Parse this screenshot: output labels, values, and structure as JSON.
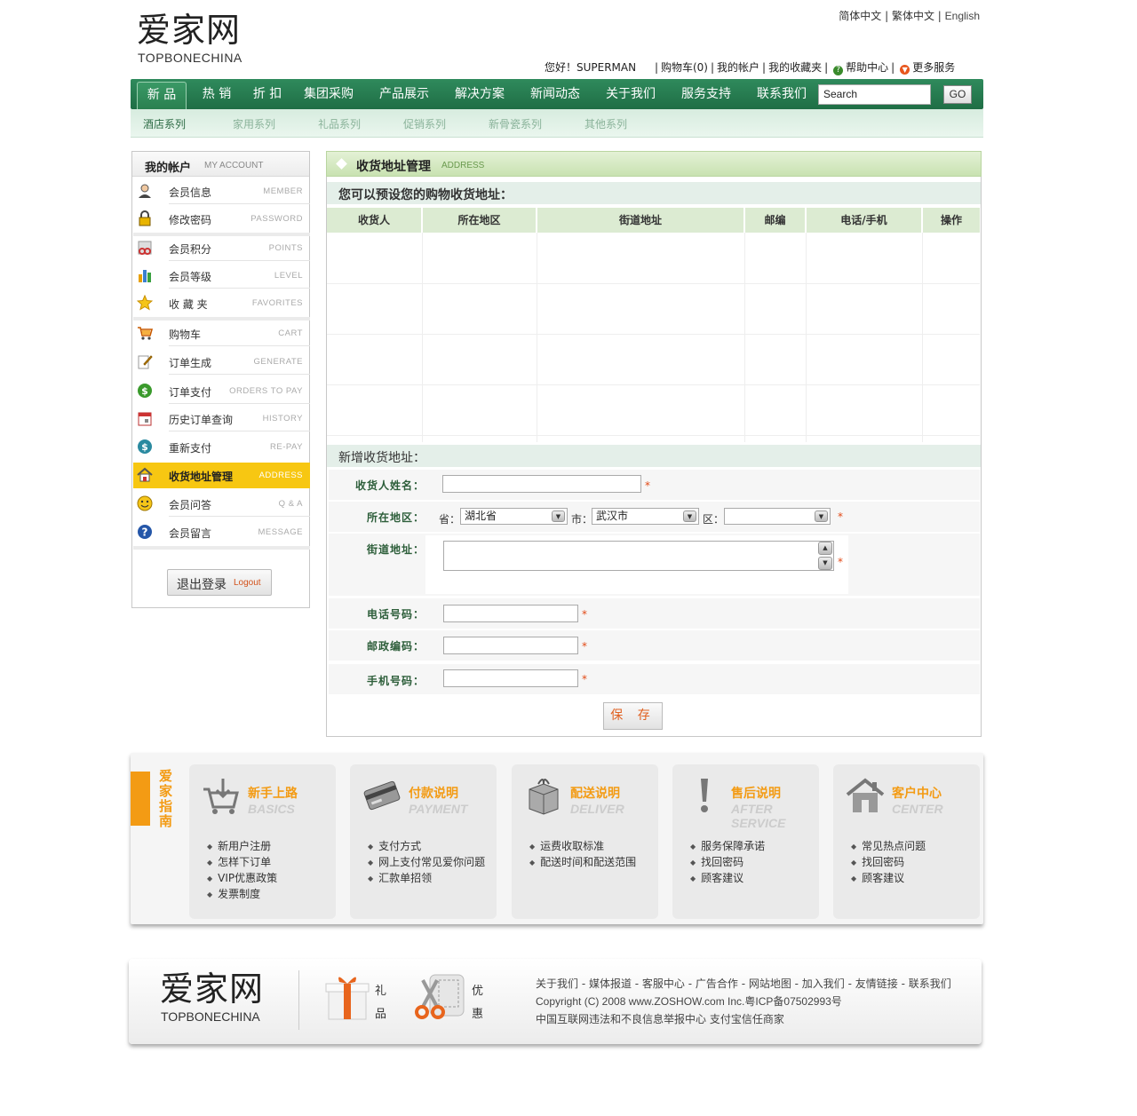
{
  "header": {
    "logo_cn": "爱家网",
    "logo_en": "TOPBONECHINA",
    "lang_simplified": "简体中文",
    "lang_traditional": "繁体中文",
    "lang_english": "English",
    "greeting": "您好！SUPERMAN",
    "cart": "购物车(0)",
    "my_account": "我的帐户",
    "favorites": "我的收藏夹",
    "help": "帮助中心",
    "more": "更多服务"
  },
  "nav": {
    "items": [
      "新 品",
      "热 销",
      "折 扣",
      "集团采购",
      "产品展示",
      "解决方案",
      "新闻动态",
      "关于我们",
      "服务支持",
      "联系我们"
    ],
    "search_value": "Search",
    "go_label": "GO"
  },
  "subnav": {
    "items": [
      "酒店系列",
      "家用系列",
      "礼品系列",
      "促销系列",
      "新骨瓷系列",
      "其他系列"
    ]
  },
  "sidebar": {
    "title_cn": "我的帐户",
    "title_en": "MY ACCOUNT",
    "items": [
      {
        "cn": "会员信息",
        "en": "MEMBER"
      },
      {
        "cn": "修改密码",
        "en": "PASSWORD"
      },
      {
        "cn": "会员积分",
        "en": "POINTS"
      },
      {
        "cn": "会员等级",
        "en": "LEVEL"
      },
      {
        "cn": "收 藏 夹",
        "en": "FAVORITES"
      },
      {
        "cn": "购物车",
        "en": "CART"
      },
      {
        "cn": "订单生成",
        "en": "GENERATE"
      },
      {
        "cn": "订单支付",
        "en": "ORDERS TO PAY"
      },
      {
        "cn": "历史订单查询",
        "en": "HISTORY"
      },
      {
        "cn": "重新支付",
        "en": "RE-PAY"
      },
      {
        "cn": "收货地址管理",
        "en": "ADDRESS"
      },
      {
        "cn": "会员问答",
        "en": "Q & A"
      },
      {
        "cn": "会员留言",
        "en": "MESSAGE"
      }
    ],
    "logout_cn": "退出登录",
    "logout_en": "Logout"
  },
  "main": {
    "title_cn": "收货地址管理",
    "title_en": "ADDRESS",
    "preset_title": "您可以预设您的购物收货地址：",
    "columns": [
      "收货人",
      "所在地区",
      "街道地址",
      "邮编",
      "电话/手机",
      "操作"
    ],
    "add_title": "新增收货地址：",
    "form": {
      "name_label": "收货人姓名：",
      "region_label": "所在地区：",
      "province_label": "省：",
      "province_value": "湖北省",
      "city_label": "市：",
      "city_value": "武汉市",
      "district_label": "区：",
      "district_value": "",
      "street_label": "街道地址：",
      "phone_label": "电话号码：",
      "zip_label": "邮政编码：",
      "mobile_label": "手机号码：",
      "required": "*",
      "save_label": "保 存"
    }
  },
  "guide": {
    "title": "爱家指南",
    "cards": [
      {
        "cn": "新手上路",
        "en": "BASICS",
        "items": [
          "新用户注册",
          "怎样下订单",
          "VIP优惠政策",
          "发票制度"
        ]
      },
      {
        "cn": "付款说明",
        "en": "PAYMENT",
        "items": [
          "支付方式",
          "网上支付常见爱你问题",
          "汇款单招领"
        ]
      },
      {
        "cn": "配送说明",
        "en": "DELIVER",
        "items": [
          "运费收取标准",
          "配送时间和配送范围"
        ]
      },
      {
        "cn": "售后说明",
        "en": "AFTER SERVICE",
        "items": [
          "服务保障承诺",
          "找回密码",
          "顾客建议"
        ]
      },
      {
        "cn": "客户中心",
        "en": "CENTER",
        "items": [
          "常见热点问题",
          "找回密码",
          "顾客建议"
        ]
      }
    ]
  },
  "footer": {
    "logo_cn": "爱家网",
    "logo_en": "TOPBONECHINA",
    "gift_label_1": "礼",
    "gift_label_2": "品",
    "promo_label_1": "优",
    "promo_label_2": "惠",
    "links": "关于我们 - 媒体报道 - 客服中心 - 广告合作 - 网站地图 - 加入我们 - 友情链接 - 联系我们",
    "copyright": "Copyright (C) 2008 www.ZOSHOW.com Inc.粤ICP备07502993号",
    "notice": "中国互联网违法和不良信息举报中心 支付宝信任商家"
  }
}
